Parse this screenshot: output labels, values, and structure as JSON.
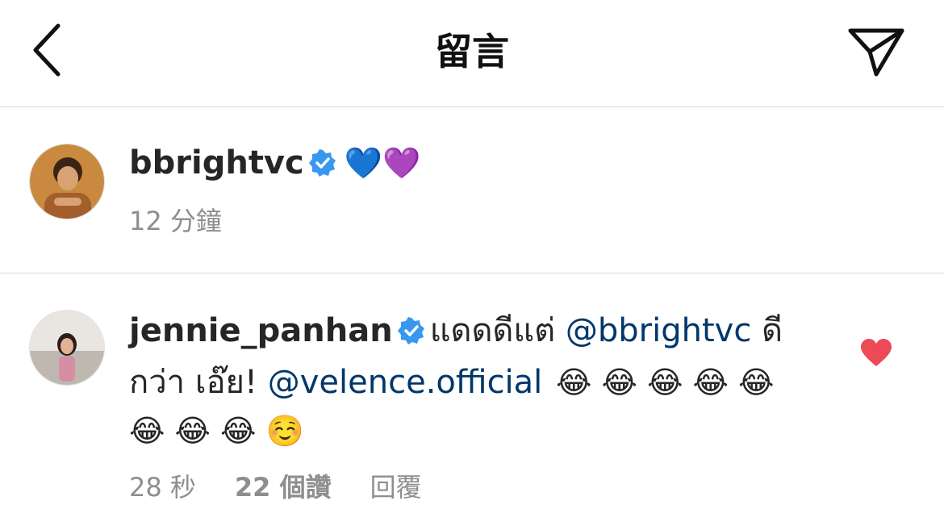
{
  "header": {
    "title": "留言",
    "back_icon": "chevron-left-icon",
    "share_icon": "paper-plane-icon"
  },
  "comments": [
    {
      "username": "bbrightvc",
      "verified": true,
      "text_emoji": "💙💜",
      "time": "12 分鐘"
    },
    {
      "username": "jennie_panhan",
      "verified": true,
      "text_part1": "แดดดีแต่ ",
      "mention1": "@bbrightvc",
      "text_part2": " ดี",
      "text_part3": "กว่า เอ๊ย! ",
      "mention2": "@velence.official",
      "emoji_line1": "😂 😂 😂 😂 😂",
      "emoji_line2": "😂 😂 😂 ☺️",
      "time": "28 秒",
      "likes": "22 個讚",
      "reply": "回覆",
      "liked": true
    }
  ],
  "colors": {
    "mention": "#00376b",
    "verified": "#3897f0",
    "heart": "#ed4956",
    "meta": "#8e8e8e",
    "divider": "#dbdbdb"
  }
}
